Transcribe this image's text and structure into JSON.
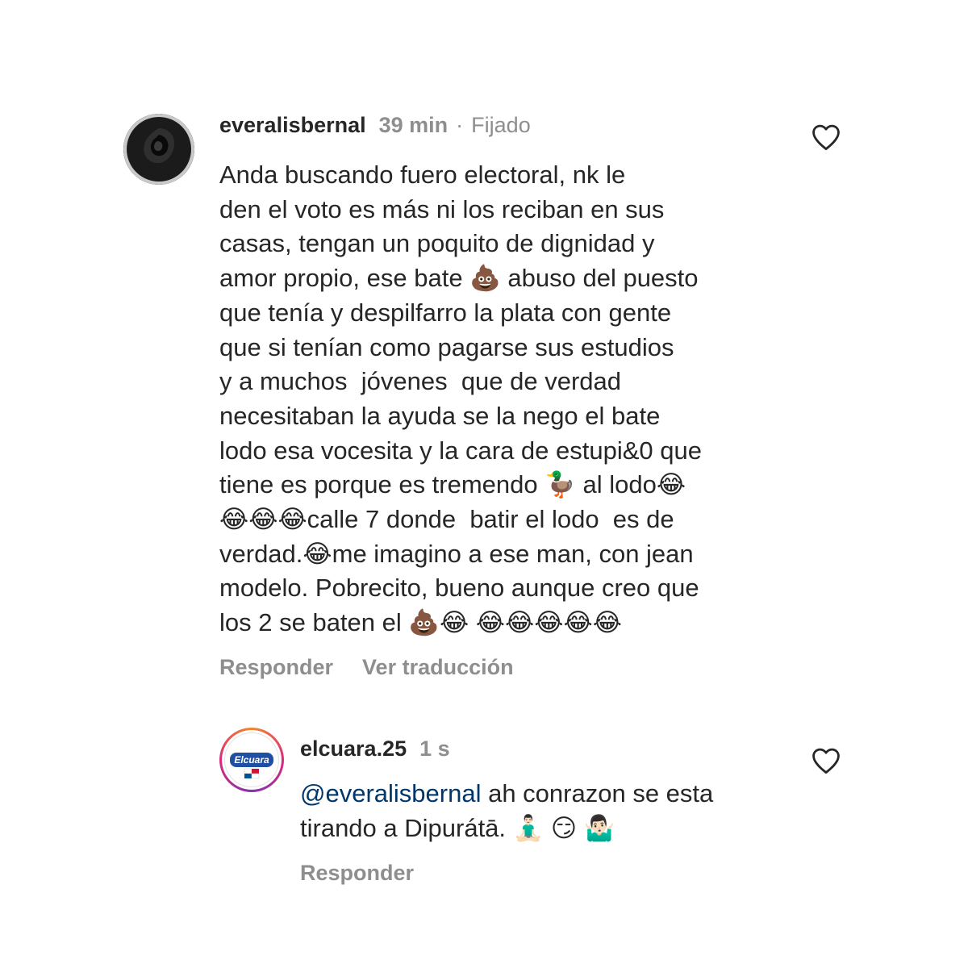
{
  "comments": [
    {
      "username": "everalisbernal",
      "time": "39 min",
      "separator": "·",
      "pinned": "Fijado",
      "lines": [
        "Anda buscando fuero electoral, nk le",
        "den el voto es más ni los reciban en sus",
        "casas, tengan un poquito de dignidad y",
        "amor propio, ese bate 💩 abuso del puesto",
        "que tenía y despilfarro la plata con gente",
        "que si tenían como pagarse sus estudios",
        "y a muchos  jóvenes  que de verdad",
        "necesitaban la ayuda se la nego el bate",
        "lodo esa vocesita y la cara de estupi&0 que",
        "tiene es porque es tremendo 🦆 al lodo😂",
        "😂😂😂calle 7 donde  batir el lodo  es de",
        "verdad.😂me imagino a ese man, con jean",
        "modelo. Pobrecito, bueno aunque creo que",
        "los 2 se baten el 💩😂 😂😂😂😂😂"
      ],
      "reply_label": "Responder",
      "translate_label": "Ver traducción",
      "like_icon": "heart-outline-icon",
      "avatar_icon": "black-rose-avatar"
    },
    {
      "username": "elcuara.25",
      "time": "1 s",
      "mention": "@everalisbernal",
      "line1_rest": " ah conrazon se esta",
      "line2": "tirando a Dipurátā. 🧘🏻‍♂️ 😏 🤷🏻‍♂️",
      "reply_label": "Responder",
      "like_icon": "heart-outline-icon",
      "avatar_icon": "el-cuara-logo-avatar",
      "avatar_logo_text": "Elcuara"
    }
  ],
  "colors": {
    "text": "#262626",
    "secondary": "#8e8e8e",
    "mention": "#00376b",
    "background": "#ffffff"
  }
}
